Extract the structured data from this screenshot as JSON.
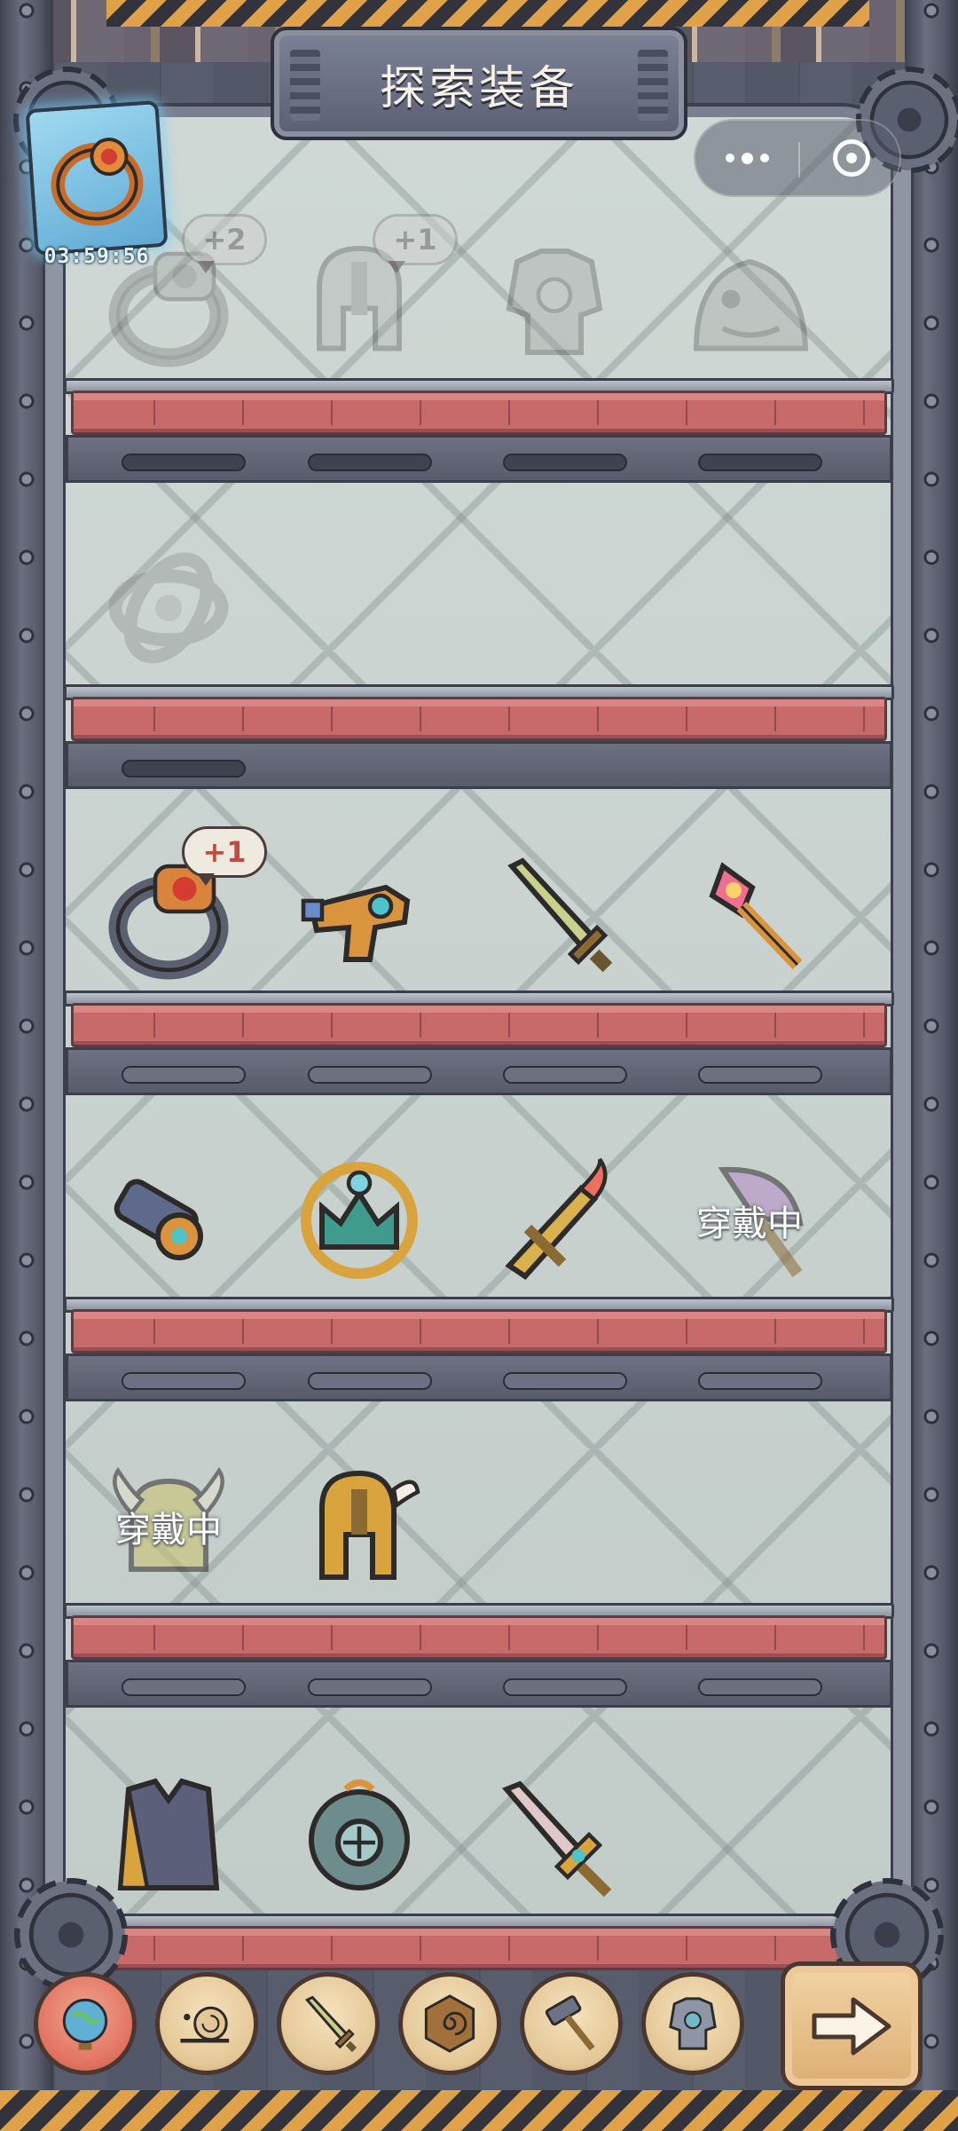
{
  "header": {
    "title": "探索装备"
  },
  "mini_program_capsule": {
    "more_icon": "more-dots-icon",
    "close_icon": "target-circle-icon"
  },
  "ring_card": {
    "timer": "03:59:56",
    "icon": "ring-icon"
  },
  "shelves": [
    {
      "items": [
        {
          "icon": "ring-icon",
          "locked": true,
          "badge": "+2"
        },
        {
          "icon": "helmet-icon",
          "locked": true,
          "badge": "+1"
        },
        {
          "icon": "armor-icon",
          "locked": true
        },
        {
          "icon": "fish-armor-icon",
          "locked": true
        }
      ]
    },
    {
      "items": [
        {
          "icon": "gyro-ring-icon",
          "locked": true
        }
      ]
    },
    {
      "items": [
        {
          "icon": "ring-icon",
          "locked": false,
          "badge": "+1"
        },
        {
          "icon": "blaster-gun-icon",
          "locked": false
        },
        {
          "icon": "sword-icon",
          "locked": false
        },
        {
          "icon": "crystal-staff-icon",
          "locked": false
        }
      ]
    },
    {
      "items": [
        {
          "icon": "cannon-gun-icon",
          "locked": false
        },
        {
          "icon": "crown-icon",
          "locked": false
        },
        {
          "icon": "flame-sword-icon",
          "locked": false
        },
        {
          "icon": "axe-icon",
          "locked": false,
          "status": "穿戴中"
        }
      ]
    },
    {
      "items": [
        {
          "icon": "horned-helmet-icon",
          "locked": false,
          "status": "穿戴中"
        },
        {
          "icon": "knight-helmet-icon",
          "locked": false
        }
      ]
    },
    {
      "items": [
        {
          "icon": "coat-armor-icon",
          "locked": false
        },
        {
          "icon": "diving-helmet-icon",
          "locked": false
        },
        {
          "icon": "gem-sword-icon",
          "locked": false
        }
      ]
    }
  ],
  "toolbar": {
    "tabs": [
      {
        "icon": "globe-icon",
        "active": true
      },
      {
        "icon": "snail-icon",
        "active": false
      },
      {
        "icon": "sword-icon",
        "active": false
      },
      {
        "icon": "spiral-shield-icon",
        "active": false
      },
      {
        "icon": "hammer-icon",
        "active": false
      },
      {
        "icon": "armor-icon",
        "active": false
      }
    ],
    "next_icon": "arrow-right-icon"
  },
  "colors": {
    "shelf_red": "#c96a6a",
    "glass": "#c9d3cf",
    "frame": "#535868",
    "badge_text": "#c44b43",
    "button_gold": "#e4c796"
  }
}
